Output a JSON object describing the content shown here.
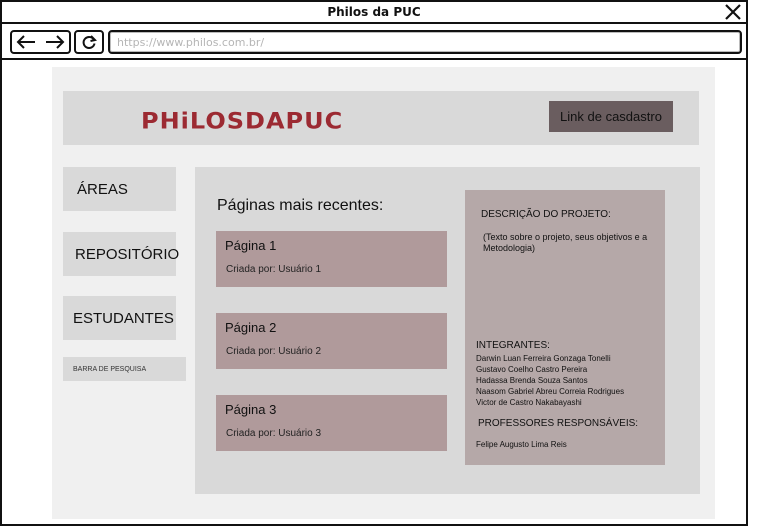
{
  "window": {
    "title": "Philos da PUC",
    "url": "https://www.philos.com.br/"
  },
  "header": {
    "logo": "PHiLOSDAPUC",
    "register_button": "Link de casdastro"
  },
  "sidebar": {
    "items": [
      {
        "label": "ÁREAS"
      },
      {
        "label": "REPOSITÓRIO"
      },
      {
        "label": "ESTUDANTES"
      }
    ],
    "search_label": "BARRA DE PESQUISA"
  },
  "main": {
    "heading": "Páginas mais recentes:",
    "cards": [
      {
        "title": "Página 1",
        "author": "Criada por: Usuário 1"
      },
      {
        "title": "Página 2",
        "author": "Criada por: Usuário 2"
      },
      {
        "title": "Página 3",
        "author": "Criada por: Usuário 3"
      }
    ]
  },
  "description": {
    "title": "DESCRIÇÃO DO PROJETO:",
    "text": "(Texto sobre o projeto, seus objetivos e a Metodologia)",
    "members_title": "INTEGRANTES:",
    "members": [
      "Darwin Luan Ferreira Gonzaga Tonelli",
      "Gustavo Coelho Castro Pereira",
      "Hadassa Brenda Souza Santos",
      "Naasom Gabriel Abreu Correia Rodrigues",
      "Victor de Castro Nakabayashi"
    ],
    "professors_title": "PROFESSORES RESPONSÁVEIS:",
    "professor": "Felipe Augusto Lima Reis"
  },
  "icons": {
    "close": "close-icon",
    "back": "arrow-left-icon",
    "forward": "arrow-right-icon",
    "reload": "reload-icon"
  },
  "colors": {
    "logo": "#9c2a32",
    "register_button": "#6a5d5f",
    "card": "#b09a9b",
    "description_panel": "#b5a8a8",
    "panel_gray": "#d9d9d9"
  }
}
